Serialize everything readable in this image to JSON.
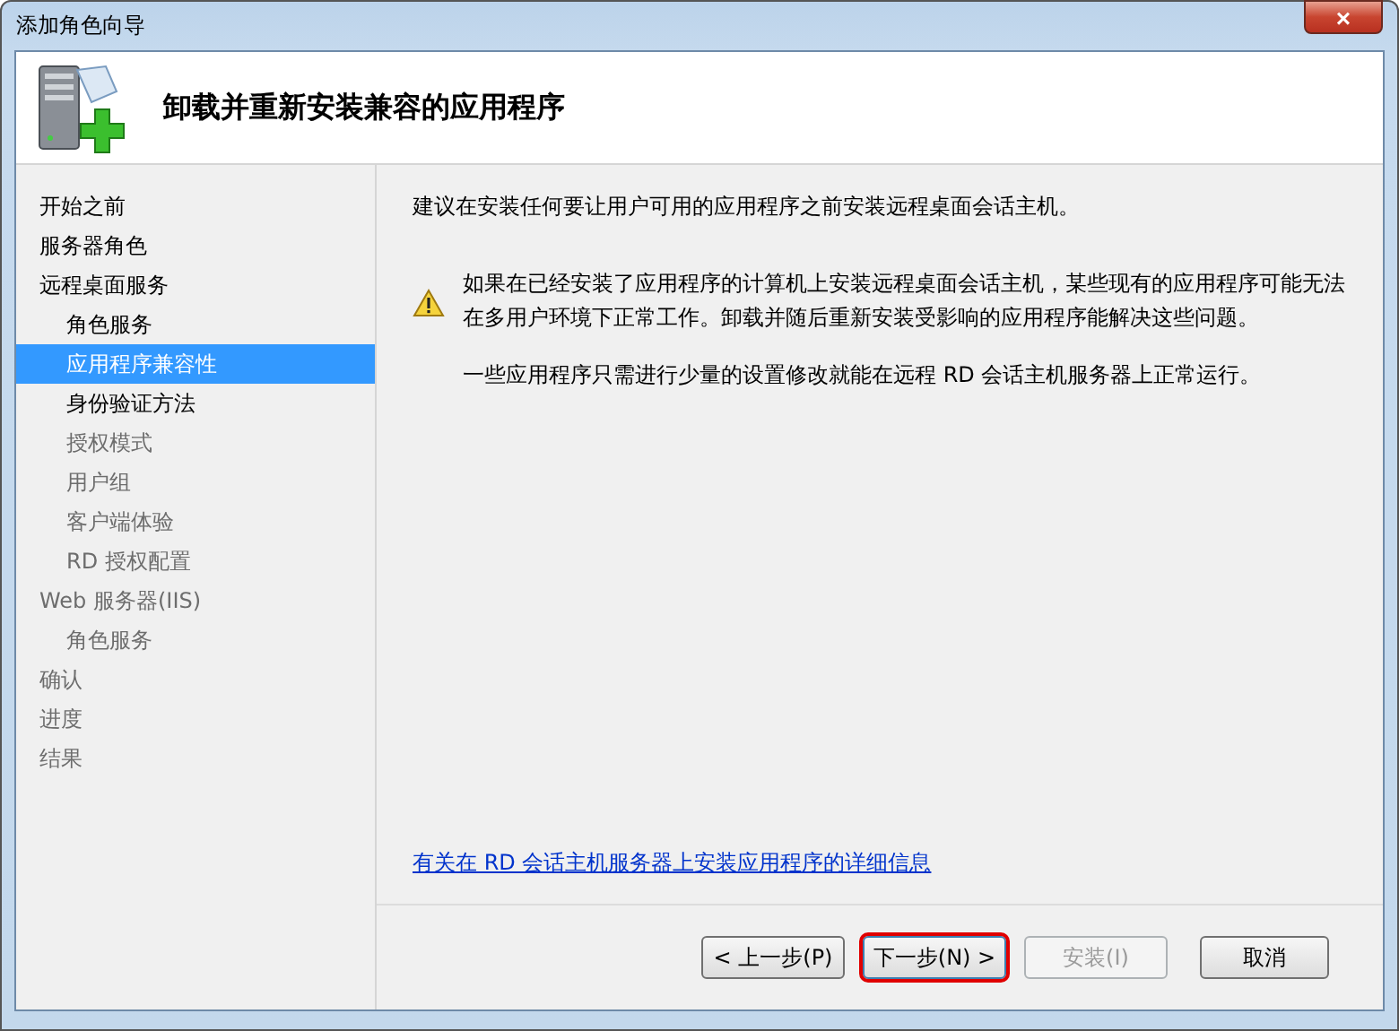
{
  "window": {
    "title": "添加角色向导",
    "close_label": "×"
  },
  "header": {
    "title": "卸载并重新安装兼容的应用程序"
  },
  "nav": [
    {
      "label": "开始之前",
      "selected": false,
      "disabled": false
    },
    {
      "label": "服务器角色",
      "selected": false,
      "disabled": false
    },
    {
      "label": "远程桌面服务",
      "selected": false,
      "disabled": false,
      "children": [
        {
          "label": "角色服务",
          "selected": false,
          "disabled": false
        },
        {
          "label": "应用程序兼容性",
          "selected": true,
          "disabled": false
        },
        {
          "label": "身份验证方法",
          "selected": false,
          "disabled": false
        },
        {
          "label": "授权模式",
          "selected": false,
          "disabled": true
        },
        {
          "label": "用户组",
          "selected": false,
          "disabled": true
        },
        {
          "label": "客户端体验",
          "selected": false,
          "disabled": true
        },
        {
          "label": "RD 授权配置",
          "selected": false,
          "disabled": true
        }
      ]
    },
    {
      "label": "Web 服务器(IIS)",
      "selected": false,
      "disabled": true,
      "children": [
        {
          "label": "角色服务",
          "selected": false,
          "disabled": true
        }
      ]
    },
    {
      "label": "确认",
      "selected": false,
      "disabled": true
    },
    {
      "label": "进度",
      "selected": false,
      "disabled": true
    },
    {
      "label": "结果",
      "selected": false,
      "disabled": true
    }
  ],
  "content": {
    "intro": "建议在安装任何要让用户可用的应用程序之前安装远程桌面会话主机。",
    "warning": "如果在已经安装了应用程序的计算机上安装远程桌面会话主机，某些现有的应用程序可能无法在多用户环境下正常工作。卸载并随后重新安装受影响的应用程序能解决这些问题。",
    "note": "一些应用程序只需进行少量的设置修改就能在远程 RD 会话主机服务器上正常运行。",
    "link": "有关在 RD 会话主机服务器上安装应用程序的详细信息"
  },
  "buttons": [
    {
      "label": "< 上一步(P)",
      "disabled": false,
      "highlighted": false
    },
    {
      "label": "下一步(N) >",
      "disabled": false,
      "highlighted": true
    },
    {
      "label": "安装(I)",
      "disabled": true,
      "highlighted": false
    },
    {
      "label": "取消",
      "disabled": false,
      "highlighted": false
    }
  ]
}
